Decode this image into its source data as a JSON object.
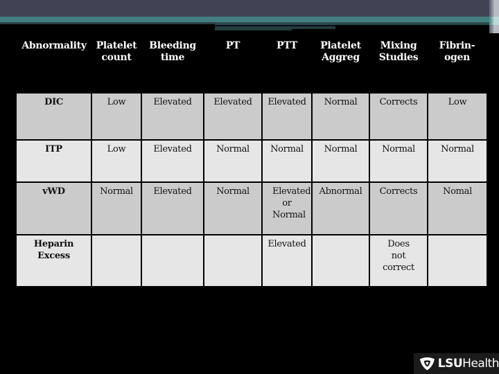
{
  "header_columns": [
    {
      "line1": "Abnormality",
      "line2": ""
    },
    {
      "line1": "Platelet",
      "line2": "count"
    },
    {
      "line1": "Bleeding",
      "line2": "time"
    },
    {
      "line1": "PT",
      "line2": ""
    },
    {
      "line1": "PTT",
      "line2": ""
    },
    {
      "line1": "Platelet",
      "line2": "Aggreg"
    },
    {
      "line1": "Mixing",
      "line2": "Studies"
    },
    {
      "line1": "Fibrin-",
      "line2": "ogen"
    }
  ],
  "rows": [
    {
      "name": "DIC",
      "cells": [
        "Low",
        "Elevated",
        "Elevated",
        "Elevated",
        "Normal",
        "Corrects",
        "Low"
      ]
    },
    {
      "name": "ITP",
      "cells": [
        "Low",
        "Elevated",
        "Normal",
        "Normal",
        "Normal",
        "Normal",
        "Normal"
      ]
    },
    {
      "name": "vWD",
      "cells": [
        "Normal",
        "Elevated",
        "Normal",
        "Elevated or Normal",
        "Abnormal",
        "Corrects",
        "Nomal"
      ]
    },
    {
      "name": "Heparin Excess",
      "cells": [
        "",
        "",
        "",
        "Elevated",
        "",
        "Does not correct",
        ""
      ]
    }
  ],
  "logo": {
    "bold": "LSU",
    "rest": "Health",
    "icon": "lsu-shield-icon"
  },
  "colors": {
    "top_band": "#414355",
    "teal_band": "#437f80",
    "row_dark": "#cbcbcb",
    "row_light": "#e6e6e6"
  }
}
